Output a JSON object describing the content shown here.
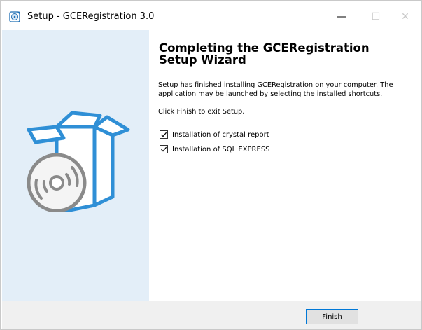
{
  "window": {
    "title": "Setup - GCERegistration 3.0",
    "minimize_glyph": "—",
    "maximize_glyph": "☐",
    "close_glyph": "✕",
    "icon": "setup-installer-icon"
  },
  "wizard": {
    "heading": "Completing the GCERegistration Setup Wizard",
    "message": "Setup has finished installing GCERegistration on your computer. The application may be launched by selecting the installed shortcuts.",
    "instruction": "Click Finish to exit Setup.",
    "options": [
      {
        "label": "Installation of crystal report",
        "checked": true
      },
      {
        "label": "Installation of SQL EXPRESS",
        "checked": true
      }
    ]
  },
  "footer": {
    "finish_label": "Finish"
  },
  "colors": {
    "left_panel": "#e3eef8",
    "accent_blue": "#2f8fd6",
    "button_border": "#0078d7"
  },
  "illustration": "open-box-with-cd-icon"
}
